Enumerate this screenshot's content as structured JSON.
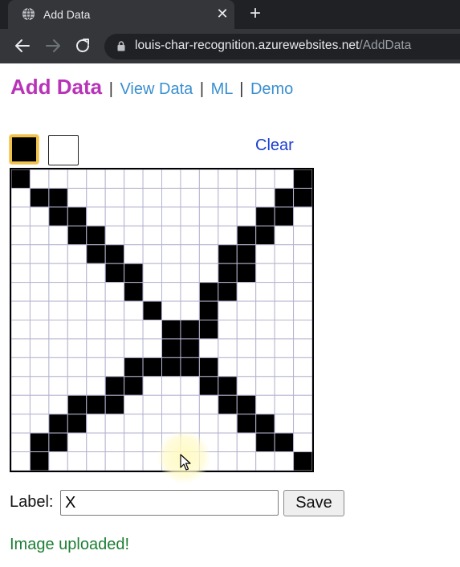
{
  "browser": {
    "tab_title": "Add Data",
    "url_host": "louis-char-recognition.azurewebsites.net",
    "url_path": "/AddData",
    "icons": {
      "tab": "globe-icon",
      "close": "close-icon",
      "new_tab": "plus-icon",
      "back": "back-arrow-icon",
      "forward": "forward-arrow-icon",
      "reload": "reload-icon",
      "lock": "lock-icon"
    }
  },
  "nav": {
    "current": "Add Data",
    "separator": "|",
    "links": [
      "View Data",
      "ML",
      "Demo"
    ]
  },
  "colors": {
    "accent": "#b833b8",
    "link": "#3a8fd0",
    "clear_link": "#1a3fcf",
    "status": "#1e7e34",
    "selected_swatch_border": "#f0c24c"
  },
  "palette": [
    "black",
    "white"
  ],
  "toolbar": {
    "clear_label": "Clear"
  },
  "grid": {
    "size": 16,
    "rows": [
      "1000000000000001",
      "0110000000000011",
      "0011000000000110",
      "0001100000001100",
      "0000110000011000",
      "0000011000011000",
      "0000001000110000",
      "0000000100100000",
      "0000000011100000",
      "0000000011000000",
      "0000001111100000",
      "0000011000110000",
      "0001110000011000",
      "0011000000001100",
      "0110000000000110",
      "0100000000000001"
    ]
  },
  "form": {
    "label": "Label:",
    "value": "X",
    "save_label": "Save"
  },
  "status": {
    "message": "Image uploaded!"
  }
}
